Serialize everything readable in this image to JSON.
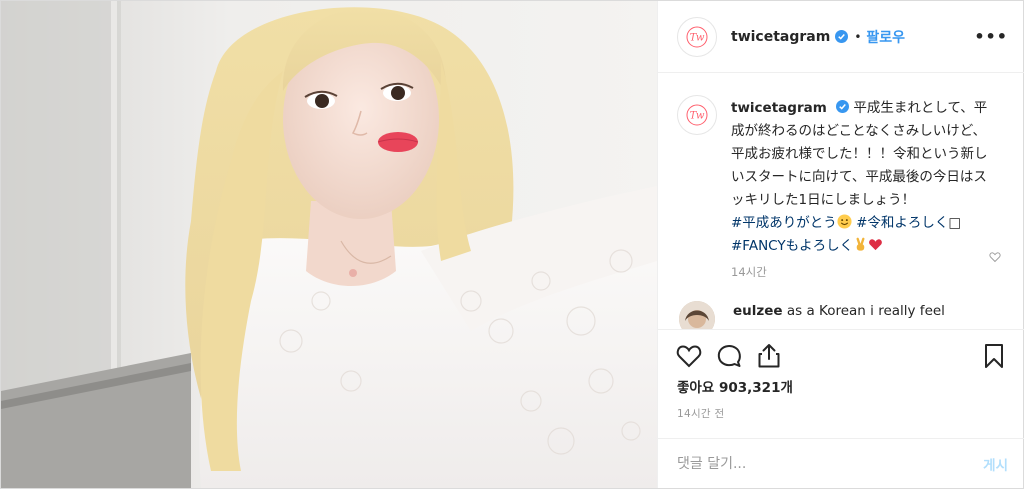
{
  "post": {
    "username": "twicetagram",
    "dot": "•",
    "follow_label": "팔로우",
    "more_label": "•••"
  },
  "caption": {
    "username": "twicetagram",
    "line1": "平成生まれとして、平成が終わるのはどことなくさみしいけど、平成お疲れ様でした！！！令和という新しいスタートに向けて、平成最後の今日はスッキリした1日にしましょう！",
    "hashtag1": "#平成ありがとう",
    "hashtag2": "#令和よろしく",
    "hashtag3": "#FANCYもよろしく",
    "time": "14시간"
  },
  "comment": {
    "username": "eulzee",
    "text": "as a Korean i really feel"
  },
  "engagement": {
    "likes_label": "좋아요",
    "likes_count": "903,321개",
    "posted_time": "14시간 전"
  },
  "composer": {
    "placeholder": "댓글 달기...",
    "post_label": "게시"
  },
  "icons": {
    "heart": "heart-icon",
    "comment": "comment-icon",
    "share": "share-icon",
    "save": "bookmark-icon",
    "verified": "verified-badge-icon"
  },
  "colors": {
    "link": "#3897f0",
    "hashtag": "#003569",
    "muted": "#999999",
    "post_disabled": "#b2dffc",
    "brand_logo": "#ff5f6d"
  }
}
